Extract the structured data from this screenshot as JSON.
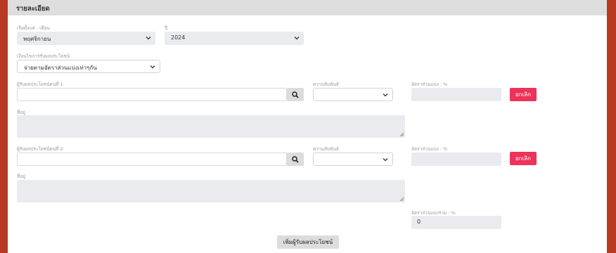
{
  "section": {
    "title": "รายละเอียด"
  },
  "start": {
    "month_label": "เริ่มตั้งแต่ : เดือน",
    "month_value": "พฤศจิกายน",
    "year_label": "ปี",
    "year_value": "2024"
  },
  "condition": {
    "label": "เงื่อนไขการรับผลประโยชน์",
    "value": "จ่ายตามอัตราส่วนแบ่งเท่าๆกัน"
  },
  "beneficiaries": [
    {
      "name_label": "ผู้รับผลประโยชน์คนที่ 1",
      "relation_label": "ความสัมพันธ์",
      "share_label": "อัตราส่วนแบ่ง : %",
      "cancel_label": "ยกเลิก",
      "address_label": "ที่อยู่"
    },
    {
      "name_label": "ผู้รับผลประโยชน์คนที่ 2",
      "relation_label": "ความสัมพันธ์",
      "share_label": "อัตราส่วนแบ่ง : %",
      "cancel_label": "ยกเลิก",
      "address_label": "ที่อยู่"
    }
  ],
  "total": {
    "label": "อัตราส่วนแบ่งรวม : %",
    "value": "0"
  },
  "add_button": "เพิ่มผู้รับผลประโยชน์",
  "colors": {
    "danger": "#ee3358",
    "frame": "#b83a22",
    "field": "#e9ebee"
  },
  "icons": {
    "search": "search-icon",
    "dropdown": "chevron-down-icon"
  }
}
